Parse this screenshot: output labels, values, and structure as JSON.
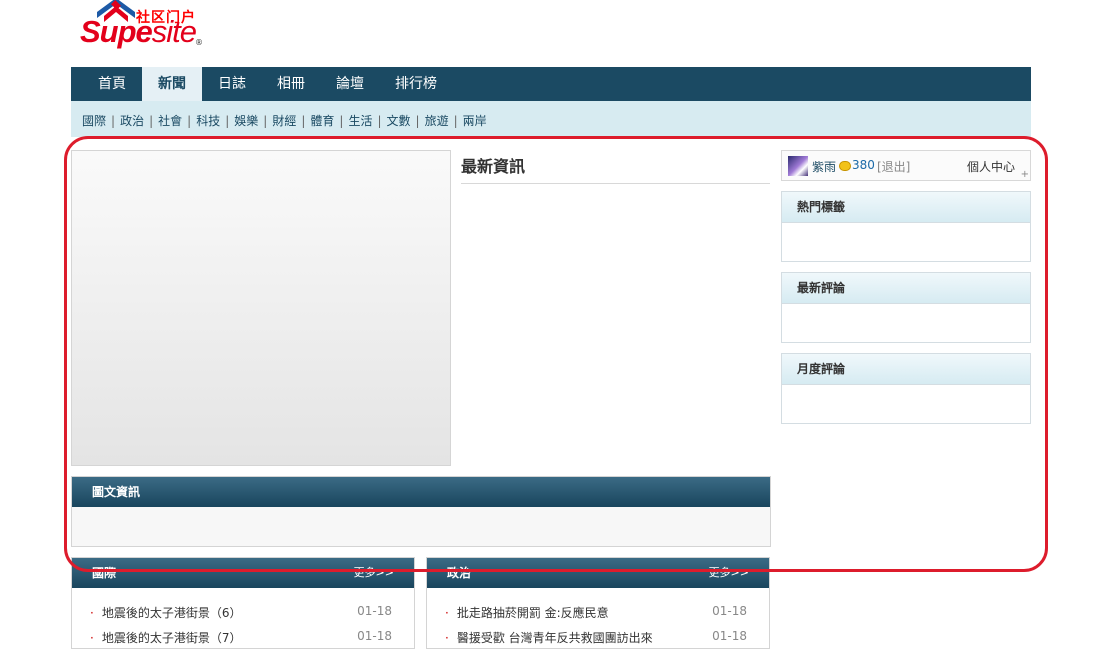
{
  "logo": {
    "tagline": "社区门户",
    "brand_a": "Supe",
    "brand_b": "site",
    "reg": "®"
  },
  "nav": {
    "items": [
      {
        "label": "首頁"
      },
      {
        "label": "新聞",
        "active": true
      },
      {
        "label": "日誌"
      },
      {
        "label": "相冊"
      },
      {
        "label": "論壇"
      },
      {
        "label": "排行榜"
      }
    ]
  },
  "subnav": {
    "items": [
      "國際",
      "政治",
      "社會",
      "科技",
      "娛樂",
      "財經",
      "體育",
      "生活",
      "文數",
      "旅遊",
      "兩岸"
    ]
  },
  "main": {
    "latest_title": "最新資訊",
    "picnews_title": "圖文資訊"
  },
  "user": {
    "name": "紫雨",
    "credits": "380",
    "logout": "[退出]",
    "center": "個人中心"
  },
  "sidebar": {
    "hot_tags": "熱門標籤",
    "latest_comments": "最新評論",
    "monthly_comments": "月度評論"
  },
  "categories": [
    {
      "title": "國際",
      "more": "更多>>",
      "items": [
        {
          "title": "地震後的太子港街景（6）",
          "date": "01-18"
        },
        {
          "title": "地震後的太子港街景（7）",
          "date": "01-18"
        }
      ]
    },
    {
      "title": "政治",
      "more": "更多>>",
      "items": [
        {
          "title": "批走路抽菸開罰 金:反應民意",
          "date": "01-18"
        },
        {
          "title": "醫援受歡 台灣青年反共救國團訪出來",
          "date": "01-18"
        }
      ]
    }
  ],
  "colors": {
    "nav_bg": "#1b4a63",
    "subnav_bg": "#d7ebf1",
    "highlight": "#dd1c2c",
    "brand_red": "#e3001b"
  }
}
